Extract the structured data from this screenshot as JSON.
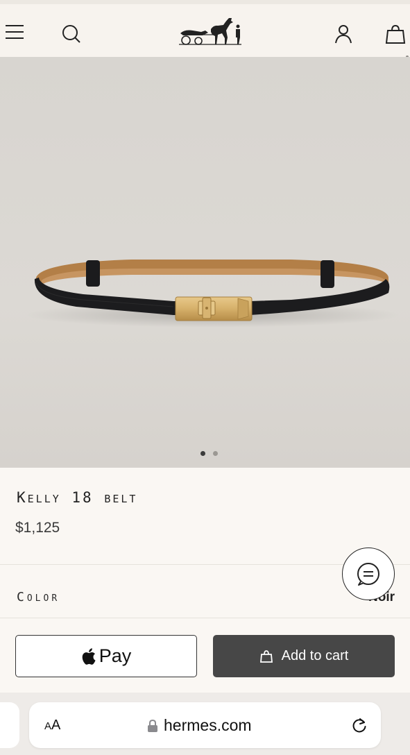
{
  "header": {
    "menu_icon": "hamburger-icon",
    "search_icon": "search-icon",
    "logo": "hermes-carriage-logo",
    "account_icon": "user-icon",
    "cart_icon": "shopping-bag-icon"
  },
  "gallery": {
    "slide_count": 2,
    "active_slide": 1
  },
  "product": {
    "name": "Kelly 18 belt",
    "price": "$1,125",
    "color_label": "Color",
    "color_value": "Noir"
  },
  "actions": {
    "apple_pay_symbol": "",
    "apple_pay_label": "Pay",
    "add_to_cart_label": "Add to cart"
  },
  "chat": {
    "icon": "chat-bubble-icon"
  },
  "browser": {
    "text_size_label_big": "A",
    "text_size_label_small": "A",
    "url": "hermes.com",
    "lock_icon": "lock-icon",
    "reload_icon": "reload-icon"
  },
  "colors": {
    "page_bg": "#faf7f3",
    "header_bg": "#f7f3ee",
    "hero_bg": "#d9d6d1",
    "cart_button_bg": "#474747",
    "belt_leather": "#1c1c1e",
    "belt_lining": "#b8844a",
    "buckle_gold": "#d9b574"
  }
}
